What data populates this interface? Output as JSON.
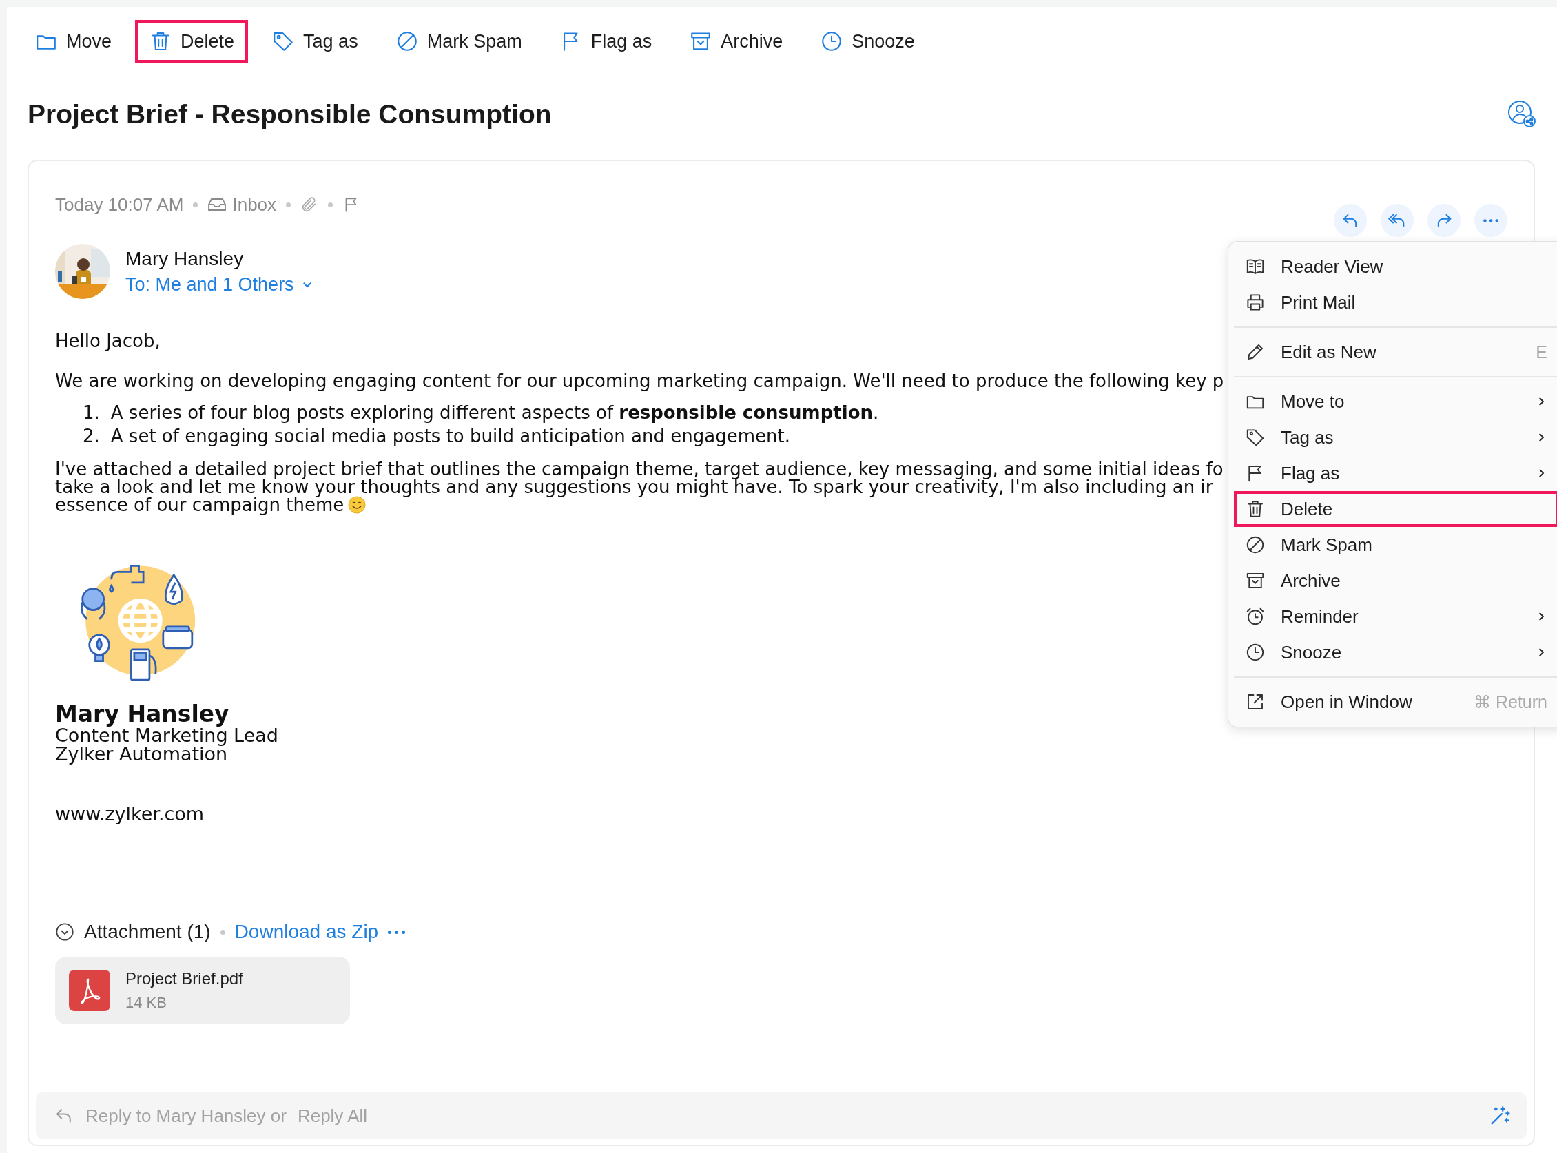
{
  "toolbar": [
    {
      "label": "Move",
      "highlighted": false
    },
    {
      "label": "Delete",
      "highlighted": true
    },
    {
      "label": "Tag as",
      "highlighted": false
    },
    {
      "label": "Mark Spam",
      "highlighted": false
    },
    {
      "label": "Flag as",
      "highlighted": false
    },
    {
      "label": "Archive",
      "highlighted": false
    },
    {
      "label": "Snooze",
      "highlighted": false
    }
  ],
  "subject": "Project Brief - Responsible Consumption",
  "message": {
    "time": "Today 10:07 AM",
    "folder": "Inbox",
    "sender": "Mary Hansley",
    "recipients": "To: Me and 1 Others",
    "greeting": "Hello Jacob,",
    "intro": "We are working on developing engaging content for our upcoming marketing campaign. We'll need to produce the following key p",
    "list": [
      {
        "number": "1.",
        "text": "A series of four blog posts exploring different aspects of **responsible consumption**."
      },
      {
        "number": "2.",
        "text": "A set of engaging social media posts to build anticipation and engagement."
      }
    ],
    "closing_lines": [
      "I've attached a detailed project brief that outlines the campaign theme, target audience, key messaging, and some initial ideas fo",
      "take a look and let me know your thoughts and any suggestions you might have. To spark your creativity, I'm also including an ir",
      "essence of our campaign theme"
    ],
    "signature": {
      "name": "Mary Hansley",
      "title": "Content Marketing Lead",
      "company": "Zylker Automation",
      "website": "www.zylker.com"
    }
  },
  "attachments": {
    "heading": "Attachment (1)",
    "download": "Download as Zip",
    "files": [
      {
        "name": "Project Brief.pdf",
        "size": "14 KB"
      }
    ]
  },
  "reply_bar": {
    "text": "Reply to Mary Hansley or",
    "reply_all": "Reply All"
  },
  "context_menu": {
    "groups": [
      [
        {
          "label": "Reader View",
          "submenu": false,
          "highlighted": false
        },
        {
          "label": "Print Mail",
          "submenu": false,
          "highlighted": false
        }
      ],
      [
        {
          "label": "Edit as New",
          "shortcut": "E",
          "submenu": false,
          "highlighted": false
        }
      ],
      [
        {
          "label": "Move to",
          "submenu": true,
          "highlighted": false
        },
        {
          "label": "Tag as",
          "submenu": true,
          "highlighted": false
        },
        {
          "label": "Flag as",
          "submenu": true,
          "highlighted": false
        },
        {
          "label": "Delete",
          "submenu": false,
          "highlighted": true
        },
        {
          "label": "Mark Spam",
          "submenu": false,
          "highlighted": false
        },
        {
          "label": "Archive",
          "submenu": false,
          "highlighted": false
        },
        {
          "label": "Reminder",
          "submenu": true,
          "highlighted": false
        },
        {
          "label": "Snooze",
          "submenu": true,
          "highlighted": false
        }
      ],
      [
        {
          "label": "Open in Window",
          "shortcut": "⌘ Return",
          "submenu": false,
          "highlighted": false
        }
      ]
    ]
  }
}
